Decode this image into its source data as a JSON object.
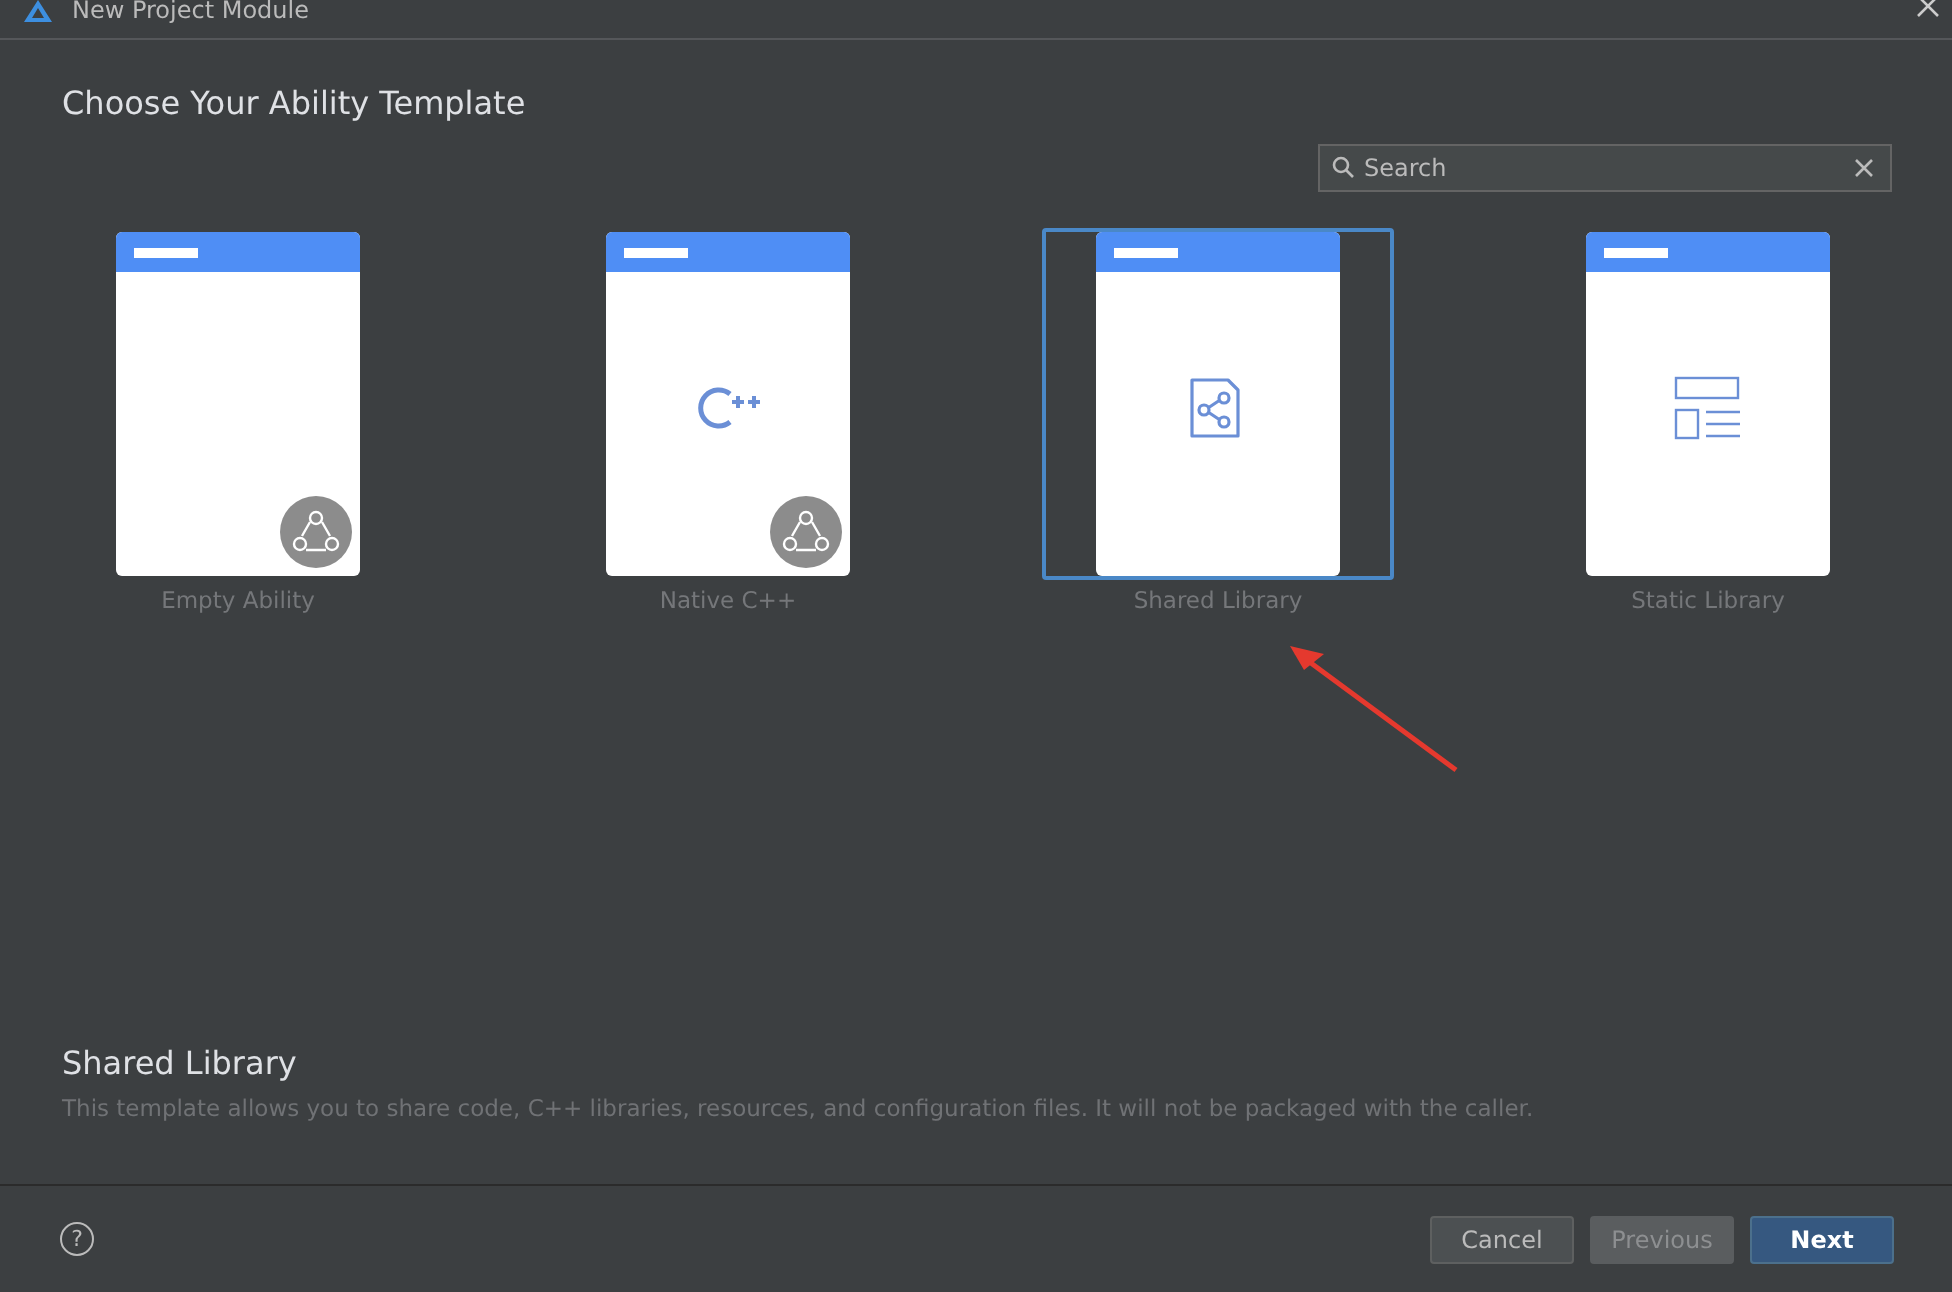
{
  "window": {
    "title": "New Project Module"
  },
  "heading": "Choose Your Ability Template",
  "search": {
    "placeholder": "Search"
  },
  "templates": [
    {
      "label": "Empty Ability",
      "kind": "empty",
      "badge": true,
      "selected": false
    },
    {
      "label": "Native C++",
      "kind": "cpp",
      "badge": true,
      "selected": false
    },
    {
      "label": "Shared Library",
      "kind": "share",
      "badge": false,
      "selected": true
    },
    {
      "label": "Static Library",
      "kind": "layout",
      "badge": false,
      "selected": false
    }
  ],
  "description": {
    "title": "Shared Library",
    "text": "This template allows you to share code, C++ libraries, resources, and configuration files. It will not be packaged with the caller."
  },
  "help": "?",
  "buttons": [
    {
      "label": "Cancel",
      "kind": "normal",
      "disabled": false
    },
    {
      "label": "Previous",
      "kind": "normal",
      "disabled": true
    },
    {
      "label": "Next",
      "kind": "primary",
      "disabled": false
    }
  ]
}
